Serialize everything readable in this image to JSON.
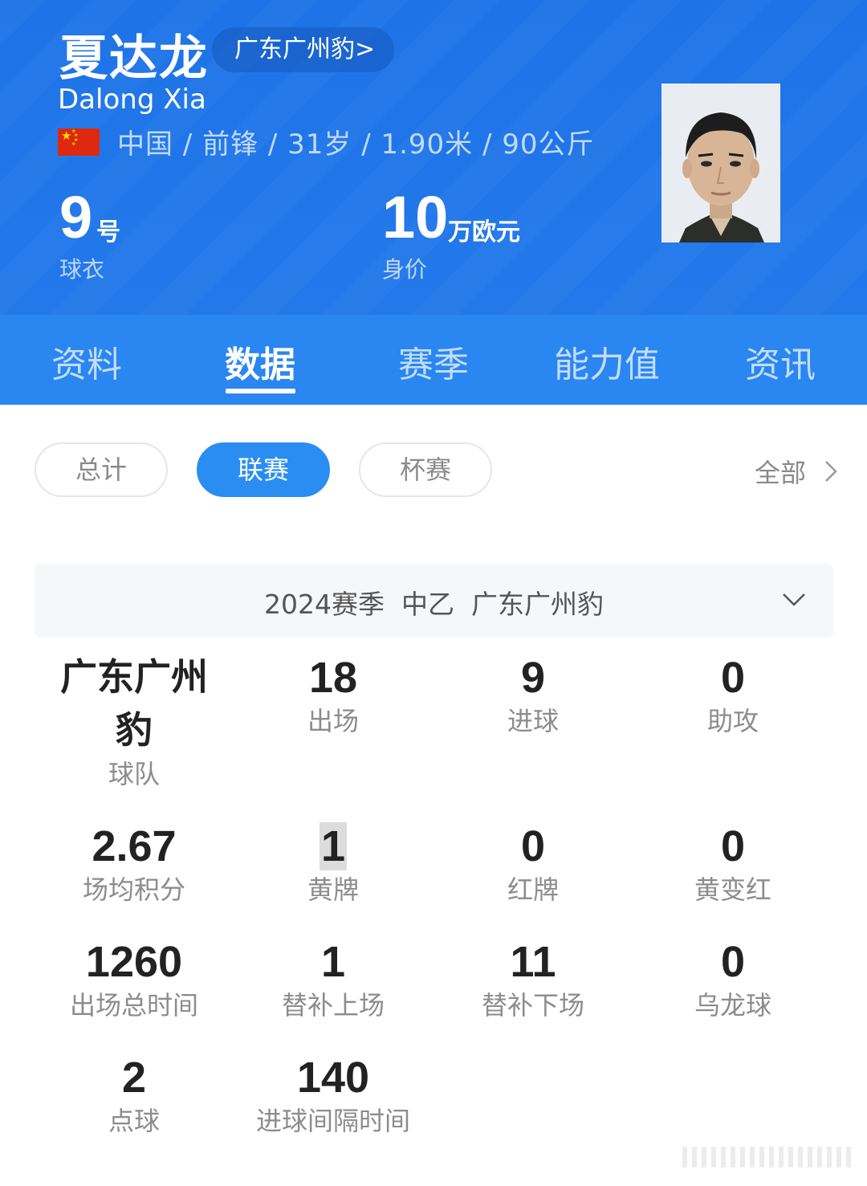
{
  "player": {
    "name_cn": "夏达龙",
    "team_pill": "广东广州豹>",
    "name_en": "Dalong Xia",
    "bio": "中国 / 前锋 / 31岁 / 1.90米 / 90公斤",
    "jersey": {
      "value": "9",
      "unit": "号",
      "label": "球衣"
    },
    "market_value": {
      "value": "10",
      "unit": "万欧元",
      "label": "身价"
    }
  },
  "tabs": [
    {
      "label": "资料"
    },
    {
      "label": "数据"
    },
    {
      "label": "赛季"
    },
    {
      "label": "能力值"
    },
    {
      "label": "资讯"
    }
  ],
  "filters": {
    "chips": [
      {
        "label": "总计"
      },
      {
        "label": "联赛"
      },
      {
        "label": "杯赛"
      }
    ],
    "all_label": "全部"
  },
  "season": {
    "text": "2024赛季  中乙  广东广州豹"
  },
  "stats": {
    "team": {
      "value": "广东广州豹",
      "label": "球队"
    },
    "appearances": {
      "value": "18",
      "label": "出场"
    },
    "goals": {
      "value": "9",
      "label": "进球"
    },
    "assists": {
      "value": "0",
      "label": "助攻"
    },
    "avg_points": {
      "value": "2.67",
      "label": "场均积分"
    },
    "yellow_cards": {
      "value": "1",
      "label": "黄牌"
    },
    "red_cards": {
      "value": "0",
      "label": "红牌"
    },
    "second_yellow": {
      "value": "0",
      "label": "黄变红"
    },
    "minutes": {
      "value": "1260",
      "label": "出场总时间"
    },
    "sub_on": {
      "value": "1",
      "label": "替补上场"
    },
    "sub_off": {
      "value": "11",
      "label": "替补下场"
    },
    "own_goals": {
      "value": "0",
      "label": "乌龙球"
    },
    "penalties": {
      "value": "2",
      "label": "点球"
    },
    "goal_interval": {
      "value": "140",
      "label": "进球间隔时间"
    }
  },
  "colors": {
    "header_blue": "#1e74e6",
    "tab_blue": "#2a86f0",
    "chip_active": "#2a8df2"
  }
}
